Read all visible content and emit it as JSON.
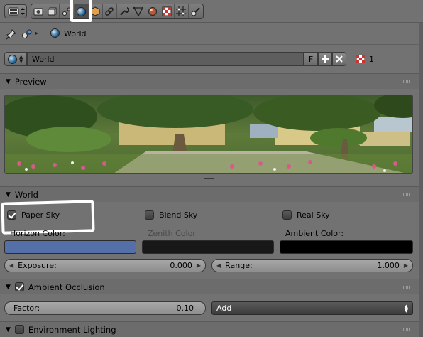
{
  "toolbar": {
    "tabs": [
      {
        "icon": "render-icon"
      },
      {
        "icon": "render-layers-icon"
      },
      {
        "icon": "scene-icon"
      },
      {
        "icon": "world-icon",
        "active": true
      },
      {
        "icon": "object-icon"
      },
      {
        "icon": "constraints-icon"
      },
      {
        "icon": "modifiers-icon"
      },
      {
        "icon": "data-icon"
      },
      {
        "icon": "material-icon"
      },
      {
        "icon": "texture-icon"
      },
      {
        "icon": "particles-icon"
      },
      {
        "icon": "physics-icon"
      }
    ]
  },
  "breadcrumb": {
    "label": "World"
  },
  "datablock": {
    "name": "World",
    "fake_user": "F",
    "users": "1"
  },
  "preview_panel": {
    "title": "Preview"
  },
  "world_panel": {
    "title": "World",
    "paper_sky": "Paper Sky",
    "blend_sky": "Blend Sky",
    "real_sky": "Real Sky",
    "horizon_label": "Horizon Color:",
    "zenith_label": "Zenith Color:",
    "ambient_label": "Ambient Color:",
    "horizon_color": "#5570a8",
    "zenith_color": "#181818",
    "ambient_color": "#000000",
    "exposure_label": "Exposure:",
    "exposure_value": "0.000",
    "range_label": "Range:",
    "range_value": "1.000"
  },
  "ao_panel": {
    "title": "Ambient Occlusion",
    "factor_label": "Factor:",
    "factor_value": "0.10",
    "blend_mode": "Add"
  },
  "env_panel": {
    "title": "Environment Lighting"
  }
}
